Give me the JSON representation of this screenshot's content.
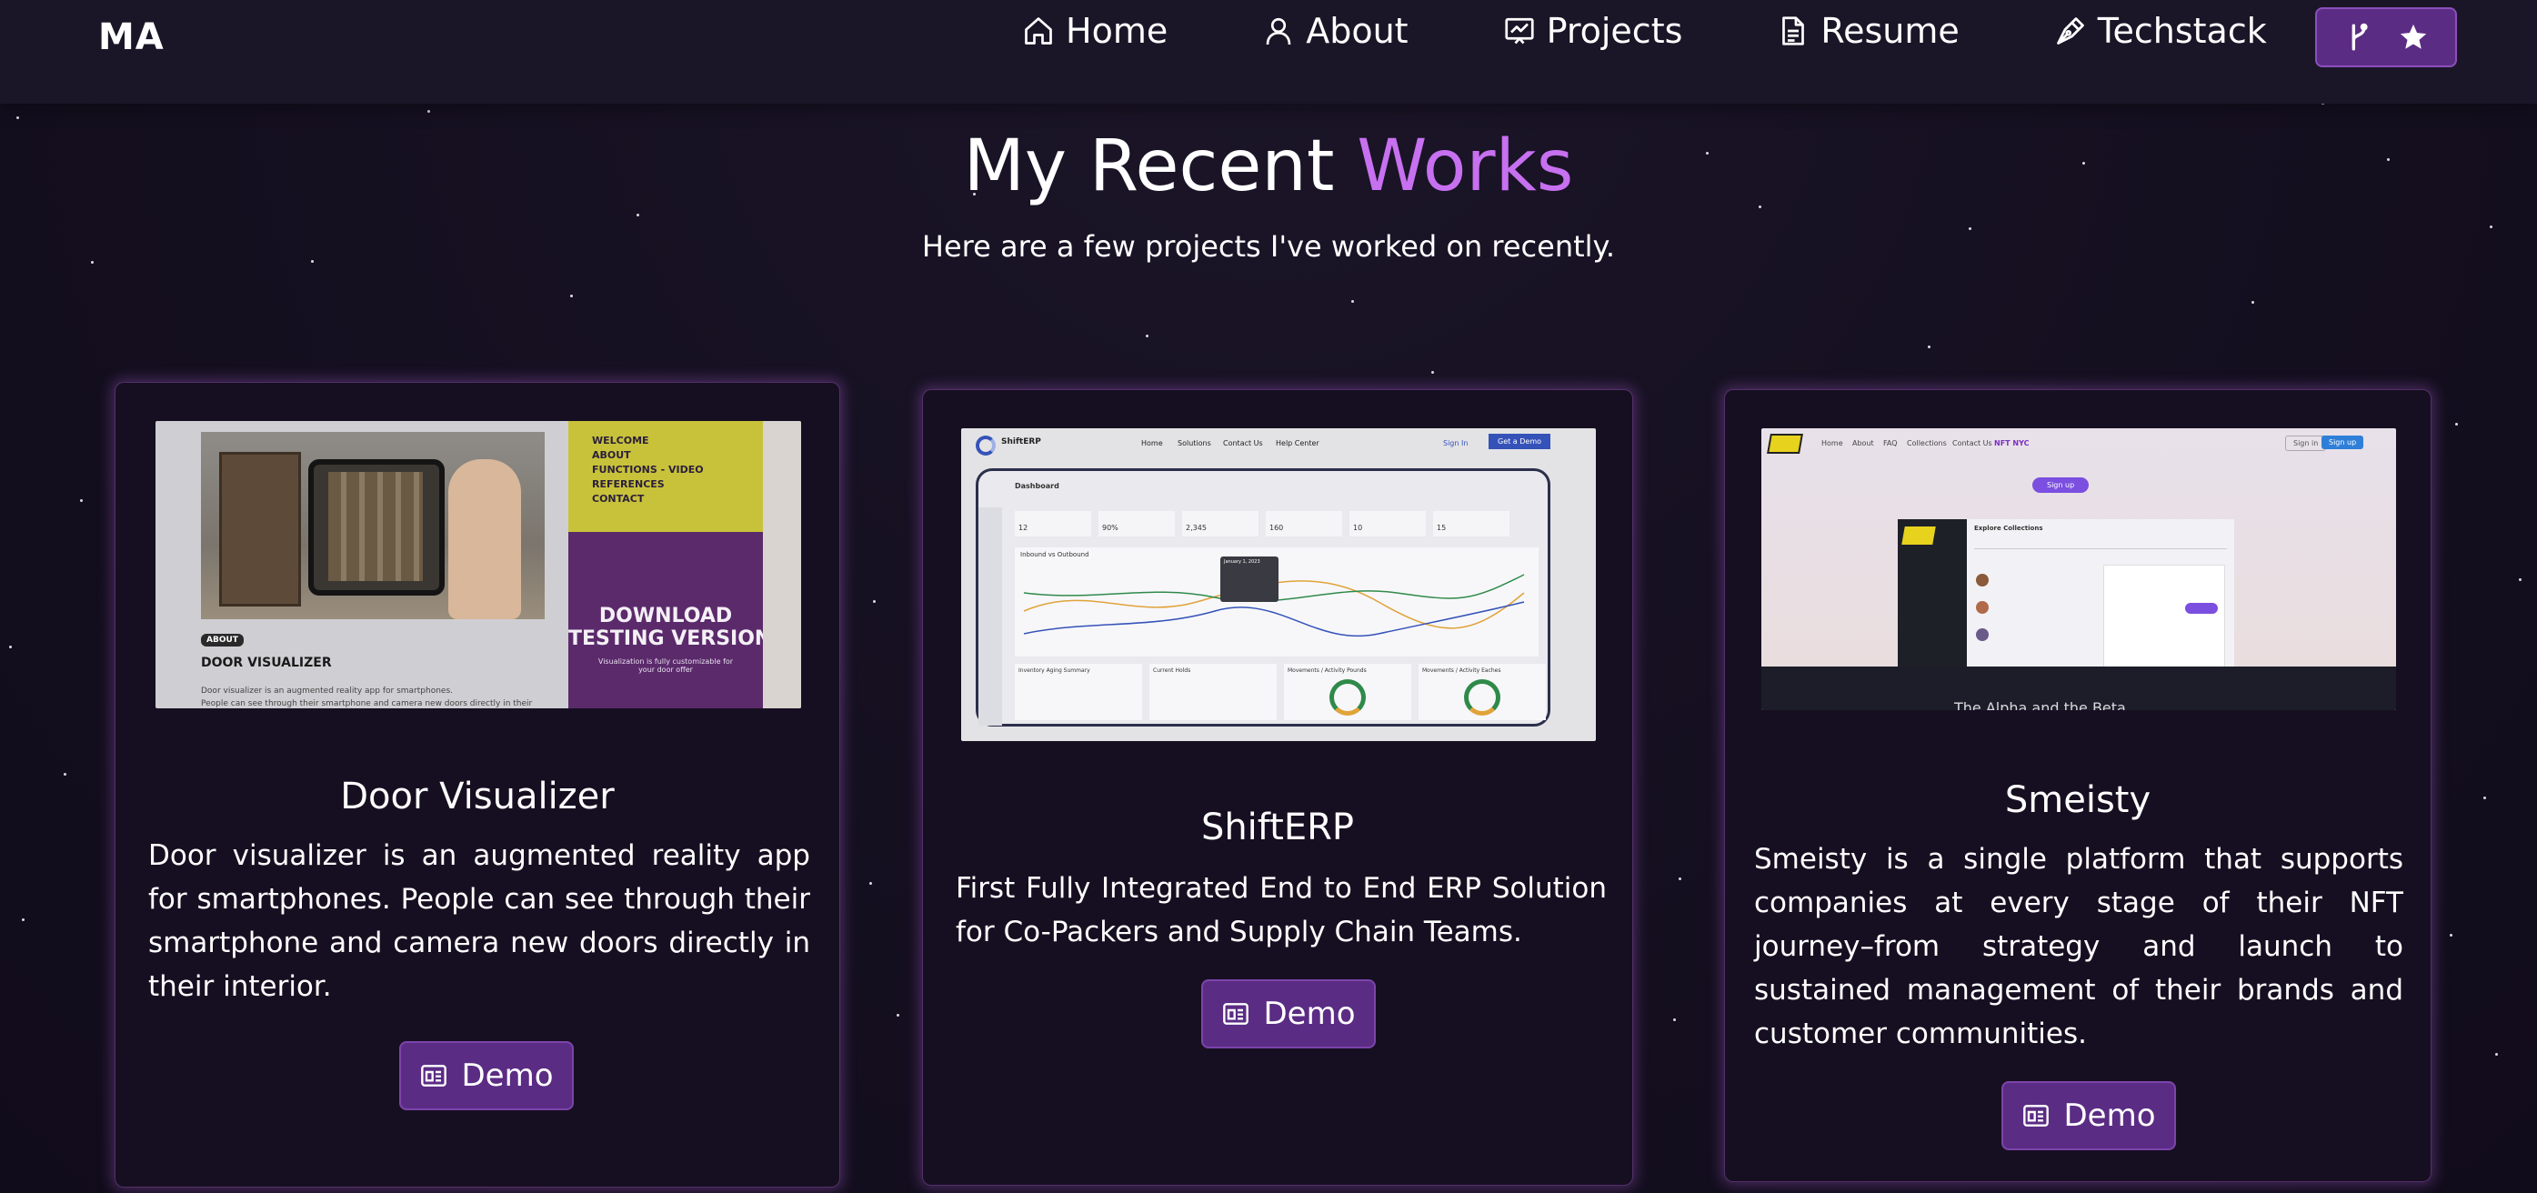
{
  "nav": {
    "logo": "MA",
    "links": [
      {
        "label": "Home",
        "icon": "home-icon"
      },
      {
        "label": "About",
        "icon": "user-icon"
      },
      {
        "label": "Projects",
        "icon": "presentation-chart-icon"
      },
      {
        "label": "Resume",
        "icon": "document-icon"
      },
      {
        "label": "Techstack",
        "icon": "pen-nib-icon"
      }
    ],
    "fork_button_icons": [
      "git-fork-icon",
      "star-icon"
    ]
  },
  "header": {
    "title_main": "My Recent",
    "title_accent": "Works",
    "subtitle": "Here are a few projects I've worked on recently."
  },
  "projects": [
    {
      "title": "Door Visualizer",
      "description": "Door visualizer is an augmented reality app for smartphones. People can see through their smartphone and camera new doors directly in their interior.",
      "button": "Demo",
      "preview": {
        "menu": [
          "WELCOME",
          "ABOUT",
          "FUNCTIONS - VIDEO",
          "REFERENCES",
          "CONTACT"
        ],
        "badge": "ABOUT",
        "heading": "DOOR VISUALIZER",
        "body_line1": "Door visualizer is an augmented reality app for smartphones.",
        "body_line2": "People can see through their smartphone and camera new doors directly in their",
        "promo_title_1": "DOWNLOAD",
        "promo_title_2": "TESTING VERSION",
        "promo_sub": "Visualization is fully customizable for your door offer"
      }
    },
    {
      "title": "ShiftERP",
      "description": "First Fully Integrated End to End ERP Solution for Co-Packers and Supply Chain Teams.",
      "button": "Demo",
      "preview": {
        "brand": "ShiftERP",
        "nav": [
          "Home",
          "Solutions",
          "Contact Us",
          "Help Center"
        ],
        "sign_in": "Sign In",
        "cta": "Get a Demo",
        "dashboard": "Dashboard",
        "chart_title": "Inbound vs Outbound",
        "tooltip_date": "January 1, 2023",
        "panels": [
          "Inventory Aging Summary",
          "Current Holds",
          "Movements / Activity Pounds",
          "Movements / Activity Eaches"
        ],
        "stats": [
          "12",
          "90%",
          "2,345",
          "160",
          "10",
          "15"
        ]
      }
    },
    {
      "title": "Smeisty",
      "description": "Smeisty is a single platform that supports companies at every stage of their NFT journey–from strategy and launch to sustained management of their brands and customer communities.",
      "button": "Demo",
      "preview": {
        "nav": [
          "Home",
          "About",
          "FAQ",
          "Collections",
          "Contact Us",
          "NFT NYC"
        ],
        "sign_in": "Sign in",
        "sign_up": "Sign up",
        "hero_button": "Sign up",
        "panel_title": "Explore Collections",
        "caption": "The Alpha and the Beta"
      }
    }
  ],
  "colors": {
    "background": "#140f1f",
    "navbar": "#1a1627",
    "accent": "#c770f0",
    "button": "#5b2c84"
  }
}
